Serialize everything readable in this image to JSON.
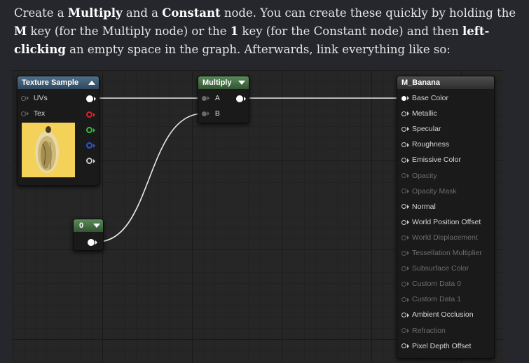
{
  "instructions": {
    "t1": "Create a ",
    "b1": "Multiply",
    "t2": " and a ",
    "b2": "Constant",
    "t3": " node. You can create these quickly by holding the ",
    "b3": "M",
    "t4": " key (for the Multiply node) or the ",
    "b4": "1",
    "t5": " key (for the Constant node) and then ",
    "b5": "left-clicking",
    "t6": " an empty space in the graph. Afterwards, link everything like so:"
  },
  "texture_node": {
    "title": "Texture Sample",
    "inputs": [
      "UVs",
      "Tex"
    ],
    "output_colors": [
      "#ffffff",
      "#e0202a",
      "#2fbf3a",
      "#2a55e0",
      "#c8c8c8"
    ]
  },
  "multiply_node": {
    "title": "Multiply",
    "inputs": [
      "A",
      "B"
    ]
  },
  "constant_node": {
    "value": "0"
  },
  "result_node": {
    "title": "M_Banana",
    "pins": [
      {
        "label": "Base Color",
        "active": true,
        "connected": true
      },
      {
        "label": "Metallic",
        "active": true,
        "connected": false
      },
      {
        "label": "Specular",
        "active": true,
        "connected": false
      },
      {
        "label": "Roughness",
        "active": true,
        "connected": false
      },
      {
        "label": "Emissive Color",
        "active": true,
        "connected": false
      },
      {
        "label": "Opacity",
        "active": false,
        "connected": false
      },
      {
        "label": "Opacity Mask",
        "active": false,
        "connected": false
      },
      {
        "label": "Normal",
        "active": true,
        "connected": false
      },
      {
        "label": "World Position Offset",
        "active": true,
        "connected": false
      },
      {
        "label": "World Displacement",
        "active": false,
        "connected": false
      },
      {
        "label": "Tessellation Multiplier",
        "active": false,
        "connected": false
      },
      {
        "label": "Subsurface Color",
        "active": false,
        "connected": false
      },
      {
        "label": "Custom Data 0",
        "active": false,
        "connected": false
      },
      {
        "label": "Custom Data 1",
        "active": false,
        "connected": false
      },
      {
        "label": "Ambient Occlusion",
        "active": true,
        "connected": false
      },
      {
        "label": "Refraction",
        "active": false,
        "connected": false
      },
      {
        "label": "Pixel Depth Offset",
        "active": true,
        "connected": false
      }
    ]
  }
}
